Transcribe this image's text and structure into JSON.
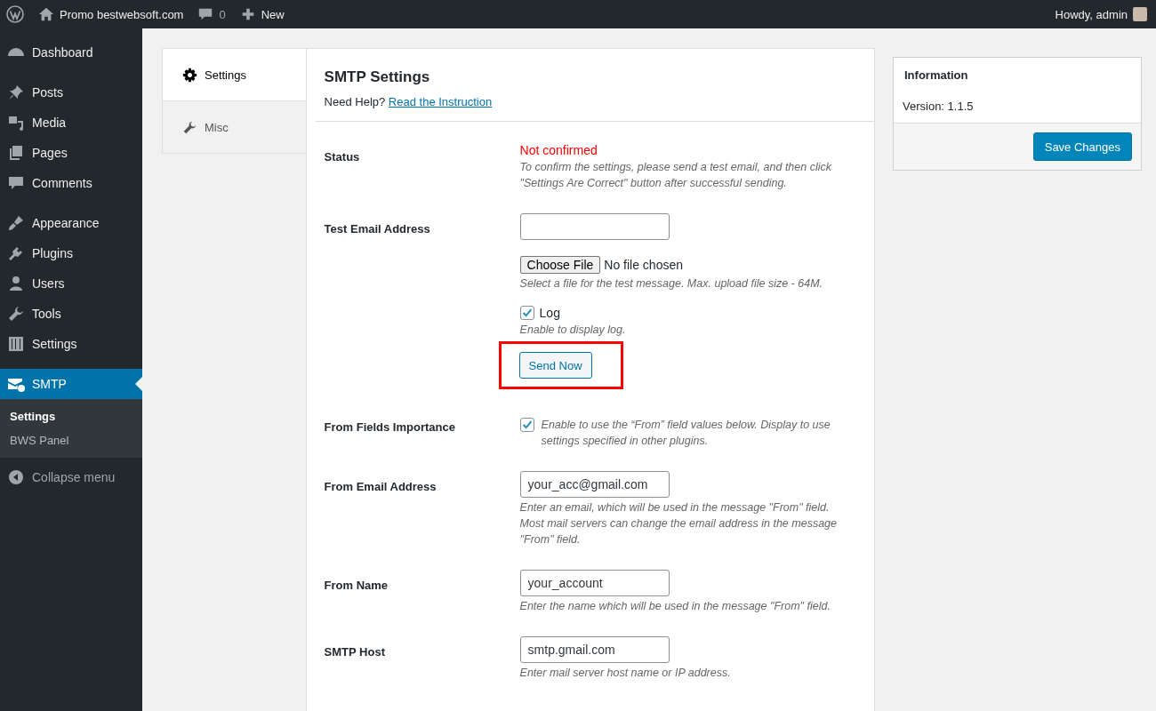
{
  "admin_bar": {
    "site_name": "Promo bestwebsoft.com",
    "comments_count": "0",
    "new_label": "New",
    "greeting": "Howdy, admin"
  },
  "sidebar": {
    "groups": [
      {
        "items": [
          {
            "label": "Dashboard",
            "kind": "dashboard",
            "selected": false
          }
        ]
      },
      {
        "items": [
          {
            "label": "Posts",
            "kind": "pin",
            "selected": false
          },
          {
            "label": "Media",
            "kind": "media",
            "selected": false
          },
          {
            "label": "Pages",
            "kind": "pages",
            "selected": false
          },
          {
            "label": "Comments",
            "kind": "comment",
            "selected": false
          }
        ]
      },
      {
        "items": [
          {
            "label": "Appearance",
            "kind": "brush",
            "selected": false
          },
          {
            "label": "Plugins",
            "kind": "plug",
            "selected": false
          },
          {
            "label": "Users",
            "kind": "user",
            "selected": false
          },
          {
            "label": "Tools",
            "kind": "wrench",
            "selected": false
          },
          {
            "label": "Settings",
            "kind": "sliders",
            "selected": false
          }
        ]
      },
      {
        "items": [
          {
            "label": "SMTP",
            "kind": "mail",
            "selected": true
          }
        ]
      }
    ],
    "submenu": [
      {
        "label": "Settings",
        "selected": true
      },
      {
        "label": "BWS Panel",
        "selected": false
      }
    ],
    "collapse_label": "Collapse menu"
  },
  "tabs": [
    {
      "label": "Settings",
      "kind": "gear",
      "selected": true
    },
    {
      "label": "Misc",
      "kind": "wrench",
      "selected": false
    }
  ],
  "panel": {
    "title": "SMTP Settings",
    "help_prefix": "Need Help?",
    "help_link": "Read the Instruction",
    "rows": [
      {
        "kind": "status",
        "label": "Status",
        "value": "Not confirmed",
        "description": "To confirm the settings, please send a test email, and then click \"Settings Are Correct\" button after successful sending."
      },
      {
        "kind": "test_email",
        "label": "Test Email Address",
        "file_button": "Choose File",
        "file_status": "No file chosen",
        "file_description": "Select a file for the test message. Max. upload file size - 64M.",
        "log": {
          "label": "Log",
          "checked": true,
          "description": "Enable to display log."
        },
        "send_button": "Send Now",
        "highlighted": true
      },
      {
        "kind": "checkbox",
        "label": "From Fields Importance",
        "checked": true,
        "description": "Enable to use the “From” field values below. Display to use settings specified in other plugins."
      },
      {
        "kind": "text",
        "label": "From Email Address",
        "value": "your_acc@gmail.com",
        "description": "Enter an email, which will be used in the message \"From\" field. Most mail servers can change the email address in the message \"From\" field."
      },
      {
        "kind": "text",
        "label": "From Name",
        "value": "your_account",
        "description": "Enter the name which will be used in the message \"From\" field."
      },
      {
        "kind": "text",
        "label": "SMTP Host",
        "value": "smtp.gmail.com",
        "description": "Enter mail server host name or IP address."
      }
    ]
  },
  "info": {
    "title": "Information",
    "version": "Version: 1.1.5",
    "save_button": "Save Changes"
  }
}
